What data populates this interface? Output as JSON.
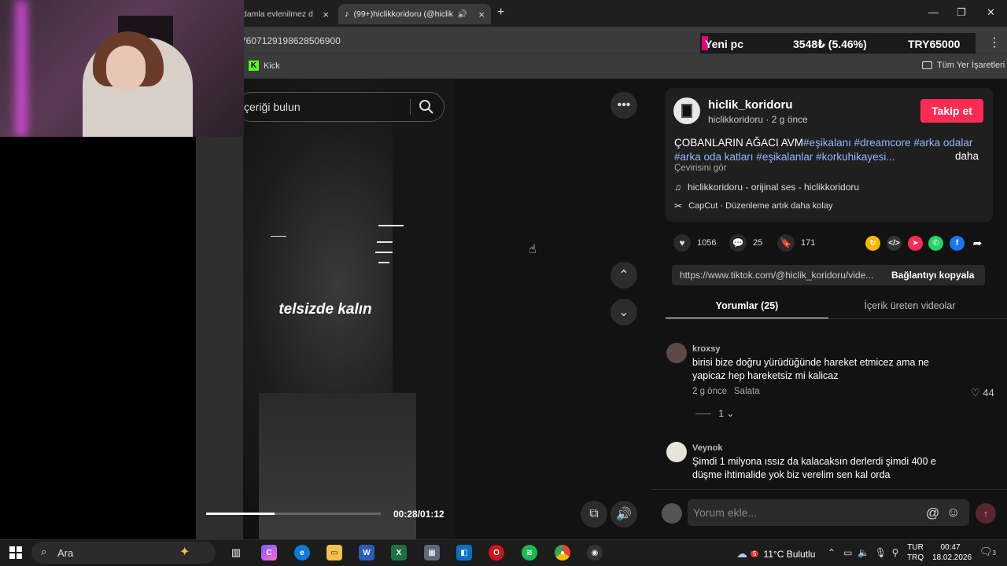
{
  "browser": {
    "tab1_title": "damla evlenilmez d",
    "tab2_title": "(99+)hiclikkoridoru (@hiclik",
    "url": "7607129198628506900",
    "bookmark_kick": "Kick",
    "all_bookmarks": "Tüm Yer İşaretleri"
  },
  "ticker": {
    "label": "Yeni pc",
    "change": "3548₺ (5.46%)",
    "price": "TRY65000"
  },
  "video": {
    "search_text": "çeriği bulun",
    "subtitle": "telsizde kalın",
    "timecode": "00:28/01:12",
    "progress": 0.39
  },
  "post": {
    "username": "hiclik_koridoru",
    "userline": "hiclikkoridoru · 2 g önce",
    "follow_label": "Takip et",
    "desc_prefix": "ÇOBANLARIN AĞACI AVM",
    "desc_tags": "#eşikalanı #dreamcore #arka odalar #arka oda katları #eşikalanlar #korkuhikayesi...",
    "more": "daha",
    "translate": "Çevirisini gör",
    "music": "hiclikkoridoru - orijinal ses - hiclikkoridoru",
    "capcut": "CapCut · Düzenleme artık daha kolay",
    "likes": "1056",
    "comments": "25",
    "saves": "171",
    "link": "https://www.tiktok.com/@hiclik_koridoru/vide...",
    "copy_link": "Bağlantıyı kopyala"
  },
  "tabs": {
    "comments": "Yorumlar (25)",
    "creator_videos": "İçerik üreten videolar"
  },
  "comments": [
    {
      "user": "kroxsy",
      "text": "birisi bize doğru yürüdüğünde hareket etmicez ama ne yapicaz hep hareketsiz mi kalicaz",
      "time": "2 g önce",
      "reply": "Salata",
      "likes": "44",
      "replies": "1"
    },
    {
      "user": "Veynok",
      "text": "Şimdi 1 milyona ıssız da kalacaksın derlerdi şimdi 400 e düşme ihtimalide yok biz verelim sen kal orda"
    }
  ],
  "composer": {
    "placeholder": "Yorum ekle..."
  },
  "taskbar": {
    "search": "Ara",
    "weather": "11°C Bulutlu",
    "lang_top": "TUR",
    "lang_bottom": "TRQ",
    "time": "00:47",
    "date": "18.02.2026",
    "weather_badge": "5",
    "notif_count": "3"
  },
  "colors": {
    "follow": "#fe2c55",
    "tag": "#8fb8ff",
    "ticker_accent": "#e6007e"
  }
}
